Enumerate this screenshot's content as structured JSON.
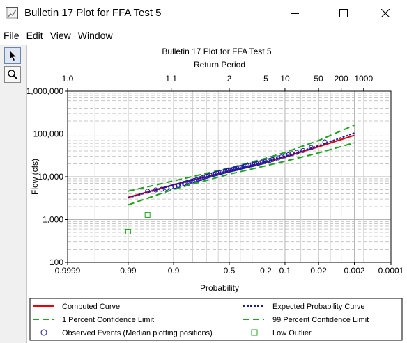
{
  "window": {
    "title": "Bulletin 17 Plot for FFA Test 5",
    "minimize_icon": "minimize-icon",
    "maximize_icon": "maximize-icon",
    "close_icon": "close-icon",
    "app_icon": "plot-icon"
  },
  "menu": {
    "items": [
      "File",
      "Edit",
      "View",
      "Window"
    ]
  },
  "tools": {
    "pointer_icon": "pointer-arrow-icon",
    "zoom_icon": "magnifier-icon"
  },
  "chart_data": {
    "type": "scatter",
    "title": "Bulletin 17 Plot for FFA Test 5",
    "x2label": "Return Period",
    "xlabel": "Probability",
    "ylabel": "Flow (cfs)",
    "yscale": "log",
    "xscale": "normal-probability-reversed",
    "ylim": [
      100,
      1000000
    ],
    "xlim": [
      0.9999,
      0.0001
    ],
    "grid": true,
    "legend_position": "bottom",
    "y_ticks": [
      {
        "value": 100,
        "label": "100"
      },
      {
        "value": 1000,
        "label": "1,000"
      },
      {
        "value": 10000,
        "label": "10,000"
      },
      {
        "value": 100000,
        "label": "100,000"
      },
      {
        "value": 1000000,
        "label": "1,000,000"
      }
    ],
    "x_ticks": [
      {
        "p": 0.9999,
        "label": "0.9999"
      },
      {
        "p": 0.99,
        "label": "0.99"
      },
      {
        "p": 0.9,
        "label": "0.9"
      },
      {
        "p": 0.5,
        "label": "0.5"
      },
      {
        "p": 0.2,
        "label": "0.2"
      },
      {
        "p": 0.1,
        "label": "0.1"
      },
      {
        "p": 0.02,
        "label": "0.02"
      },
      {
        "p": 0.002,
        "label": "0.002"
      },
      {
        "p": 0.0001,
        "label": "0.0001"
      }
    ],
    "x_minor_ticks": [
      0.999,
      0.95,
      0.8,
      0.7,
      0.6,
      0.4,
      0.3,
      0.05,
      0.01,
      0.005,
      0.001
    ],
    "top_ticks": [
      {
        "p": 0.9999,
        "label": "1.0"
      },
      {
        "p": 0.9091,
        "label": "1.1"
      },
      {
        "p": 0.5,
        "label": "2"
      },
      {
        "p": 0.2,
        "label": "5"
      },
      {
        "p": 0.1,
        "label": "10"
      },
      {
        "p": 0.02,
        "label": "50"
      },
      {
        "p": 0.005,
        "label": "200"
      },
      {
        "p": 0.001,
        "label": "1000"
      }
    ],
    "series": [
      {
        "name": "Computed Curve",
        "style": "solid",
        "color": "#e8000b",
        "points": [
          [
            0.99,
            3300
          ],
          [
            0.9,
            6500
          ],
          [
            0.5,
            13500
          ],
          [
            0.2,
            22000
          ],
          [
            0.1,
            29000
          ],
          [
            0.02,
            50000
          ],
          [
            0.002,
            93000
          ]
        ]
      },
      {
        "name": "Expected Probability Curve",
        "style": "dotted",
        "color": "#1a1aa0",
        "points": [
          [
            0.99,
            3200
          ],
          [
            0.9,
            6400
          ],
          [
            0.5,
            13500
          ],
          [
            0.2,
            22500
          ],
          [
            0.1,
            30000
          ],
          [
            0.02,
            53000
          ],
          [
            0.002,
            105000
          ]
        ]
      },
      {
        "name": "1 Percent Confidence Limit",
        "style": "dashed",
        "color": "#1aa51a",
        "points": [
          [
            0.99,
            2200
          ],
          [
            0.9,
            5100
          ],
          [
            0.5,
            11500
          ],
          [
            0.2,
            18000
          ],
          [
            0.1,
            23000
          ],
          [
            0.02,
            36000
          ],
          [
            0.002,
            62000
          ]
        ]
      },
      {
        "name": "99 Percent Confidence Limit",
        "style": "dashed",
        "color": "#1aa51a",
        "points": [
          [
            0.99,
            4600
          ],
          [
            0.9,
            8000
          ],
          [
            0.5,
            16000
          ],
          [
            0.2,
            27000
          ],
          [
            0.1,
            37000
          ],
          [
            0.02,
            70000
          ],
          [
            0.002,
            160000
          ]
        ]
      },
      {
        "name": "Observed Events (Median plotting positions)",
        "style": "circle",
        "color": "#1a1aa0",
        "points": [
          [
            0.97,
            4600
          ],
          [
            0.955,
            4900
          ],
          [
            0.94,
            5100
          ],
          [
            0.925,
            5400
          ],
          [
            0.91,
            5700
          ],
          [
            0.895,
            6000
          ],
          [
            0.88,
            6300
          ],
          [
            0.865,
            6700
          ],
          [
            0.85,
            7000
          ],
          [
            0.835,
            7300
          ],
          [
            0.82,
            7600
          ],
          [
            0.805,
            7900
          ],
          [
            0.79,
            8200
          ],
          [
            0.775,
            8500
          ],
          [
            0.76,
            8800
          ],
          [
            0.745,
            9100
          ],
          [
            0.73,
            9500
          ],
          [
            0.715,
            9900
          ],
          [
            0.7,
            10200
          ],
          [
            0.685,
            10500
          ],
          [
            0.67,
            10800
          ],
          [
            0.655,
            11100
          ],
          [
            0.64,
            11400
          ],
          [
            0.625,
            11700
          ],
          [
            0.61,
            12000
          ],
          [
            0.595,
            12300
          ],
          [
            0.58,
            12600
          ],
          [
            0.565,
            12900
          ],
          [
            0.55,
            13200
          ],
          [
            0.535,
            13500
          ],
          [
            0.52,
            13800
          ],
          [
            0.505,
            14100
          ],
          [
            0.49,
            14400
          ],
          [
            0.475,
            14700
          ],
          [
            0.46,
            15000
          ],
          [
            0.445,
            15300
          ],
          [
            0.43,
            15600
          ],
          [
            0.415,
            16000
          ],
          [
            0.4,
            16400
          ],
          [
            0.385,
            16800
          ],
          [
            0.37,
            17200
          ],
          [
            0.355,
            17600
          ],
          [
            0.34,
            18000
          ],
          [
            0.325,
            18400
          ],
          [
            0.31,
            18800
          ],
          [
            0.295,
            19200
          ],
          [
            0.28,
            19700
          ],
          [
            0.265,
            20200
          ],
          [
            0.25,
            20700
          ],
          [
            0.235,
            21300
          ],
          [
            0.22,
            21900
          ],
          [
            0.205,
            22600
          ],
          [
            0.19,
            23300
          ],
          [
            0.175,
            24100
          ],
          [
            0.16,
            25100
          ],
          [
            0.145,
            26200
          ],
          [
            0.13,
            27500
          ],
          [
            0.115,
            29000
          ],
          [
            0.1,
            30800
          ],
          [
            0.087,
            32500
          ],
          [
            0.074,
            34500
          ],
          [
            0.06,
            37000
          ],
          [
            0.045,
            41000
          ],
          [
            0.03,
            48000
          ],
          [
            0.014,
            65000
          ]
        ]
      },
      {
        "name": "Low Outlier",
        "style": "square",
        "color": "#1aa51a",
        "points": [
          [
            0.99,
            520
          ],
          [
            0.97,
            1280
          ]
        ]
      }
    ]
  },
  "legend": [
    {
      "label": "Computed Curve",
      "style": "solid",
      "color": "#e8000b",
      "col": 0,
      "row": 0
    },
    {
      "label": "Expected Probability Curve",
      "style": "dotted",
      "color": "#1a1aa0",
      "col": 1,
      "row": 0
    },
    {
      "label": "1 Percent Confidence Limit",
      "style": "dashed",
      "color": "#1aa51a",
      "col": 0,
      "row": 1
    },
    {
      "label": "99 Percent Confidence Limit",
      "style": "dashed",
      "color": "#1aa51a",
      "col": 1,
      "row": 1
    },
    {
      "label": "Observed Events (Median plotting positions)",
      "style": "circle",
      "color": "#1a1aa0",
      "col": 0,
      "row": 2
    },
    {
      "label": "Low Outlier",
      "style": "square",
      "color": "#1aa51a",
      "col": 1,
      "row": 2
    }
  ]
}
